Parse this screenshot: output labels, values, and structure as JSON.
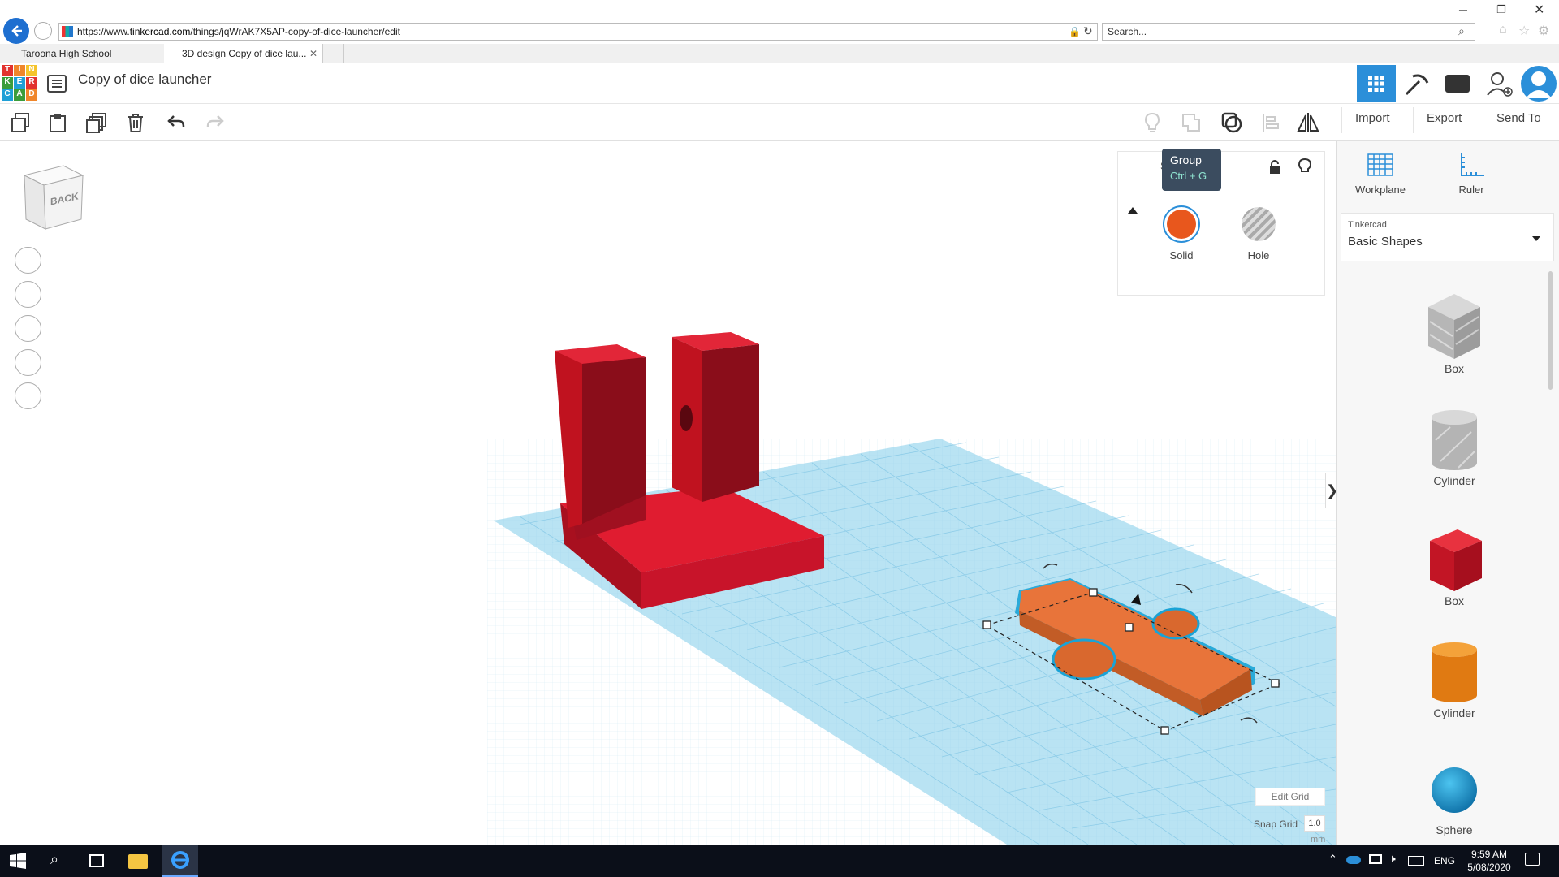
{
  "browser": {
    "url_prefix": "https://www.",
    "url_domain": "tinkercad.com",
    "url_path": "/things/jqWrAK7X5AP-copy-of-dice-launcher/edit",
    "search_placeholder": "Search...",
    "tabs": [
      {
        "label": "Taroona High School"
      },
      {
        "label": "3D design Copy of dice lau..."
      }
    ]
  },
  "app": {
    "logo_letters": [
      "T",
      "I",
      "N",
      "K",
      "E",
      "R",
      "C",
      "A",
      "D"
    ],
    "design_title": "Copy of dice launcher",
    "actions": {
      "import": "Import",
      "export": "Export",
      "send_to": "Send To"
    }
  },
  "viewcube": {
    "face_label": "BACK"
  },
  "inspector": {
    "tooltip_title": "Group",
    "tooltip_shortcut": "Ctrl + G",
    "solid_label": "Solid",
    "hole_label": "Hole",
    "partial_label": "S"
  },
  "panel": {
    "workplane": "Workplane",
    "ruler": "Ruler",
    "library_source": "Tinkercad",
    "library_name": "Basic Shapes",
    "shapes": [
      {
        "name": "Box"
      },
      {
        "name": "Cylinder"
      },
      {
        "name": "Box"
      },
      {
        "name": "Cylinder"
      },
      {
        "name": "Sphere"
      }
    ]
  },
  "grid": {
    "edit_grid": "Edit Grid",
    "snap_grid_label": "Snap Grid",
    "snap_grid_value": "1.0",
    "unit": "mm"
  },
  "taskbar": {
    "lang": "ENG",
    "time": "9:59 AM",
    "date": "5/08/2020"
  },
  "colors": {
    "accent_blue": "#2b8fd9",
    "solid_orange": "#e8571d",
    "red_part": "#d0142a",
    "orange_part": "#d96a32",
    "grid_blue": "#b9e3f3"
  }
}
